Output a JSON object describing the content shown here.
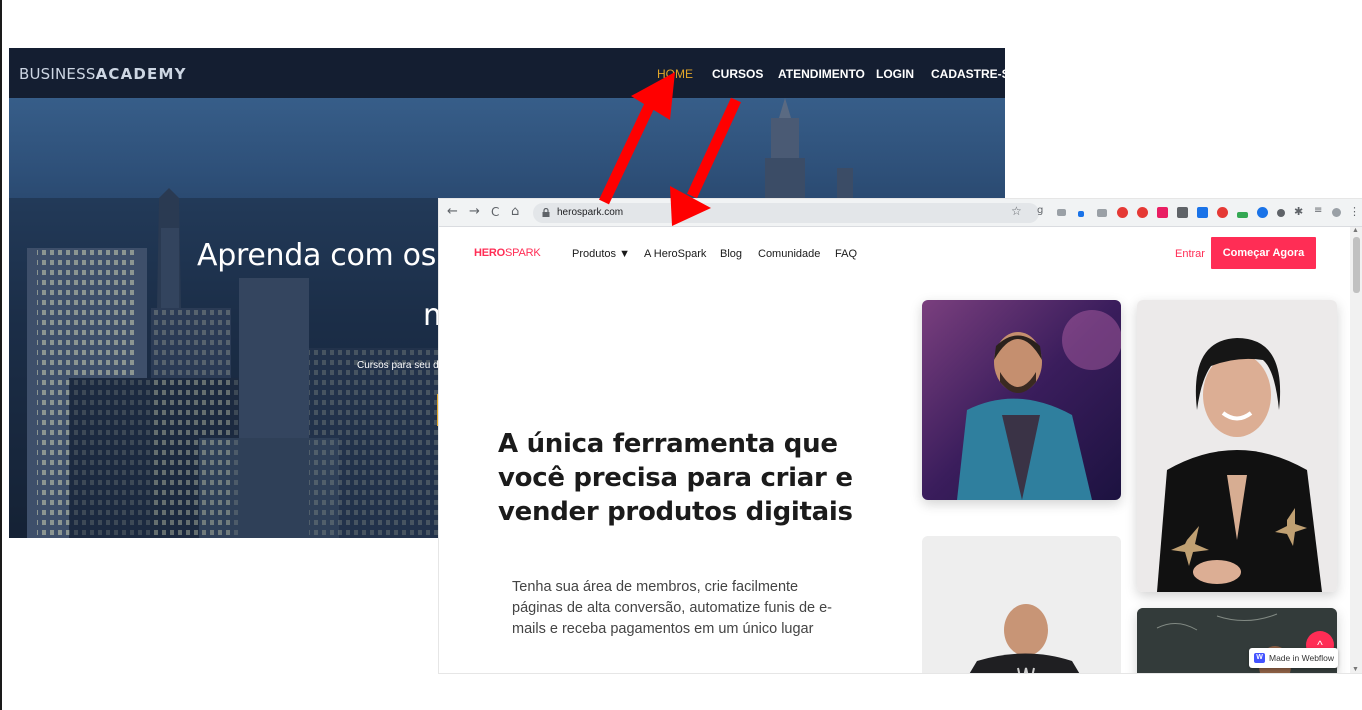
{
  "business_academy": {
    "logo_regular": "BUSINESS",
    "logo_bold": "ACADEMY",
    "menu": [
      "HOME",
      "CURSOS",
      "ATENDIMENTO",
      "LOGIN",
      "CADASTRE-SE"
    ],
    "active_menu": "HOME",
    "heading_line1": "Aprenda com os m",
    "heading_line2": "m",
    "subheading": "Cursos para seu de"
  },
  "browser": {
    "url": "herospark.com",
    "back_icon": "←",
    "forward_icon": "→",
    "reload_icon": "C",
    "home_icon": "⌂",
    "star_icon": "☆",
    "menu_icon": "⋮"
  },
  "herospark": {
    "logo_bold": "HERO",
    "logo_regular": "SPARK",
    "nav": [
      "Produtos ▼",
      "A HeroSpark",
      "Blog",
      "Comunidade",
      "FAQ"
    ],
    "login": "Entrar",
    "cta": "Começar Agora",
    "hero_title": "A única ferramenta que você precisa para criar e vender produtos digitais",
    "hero_description": "Tenha sua área de membros, crie facilmente páginas de alta conversão, automatize funis de e-mails e receba pagamentos em um único lugar",
    "fab_icon": "^",
    "badge_icon": "W",
    "badge_text": "Made in Webflow"
  },
  "colors": {
    "brand_pink": "#ff2d55",
    "academy_nav": "#141e31",
    "academy_gold": "#e2a629",
    "arrow_red": "#ff0000"
  }
}
